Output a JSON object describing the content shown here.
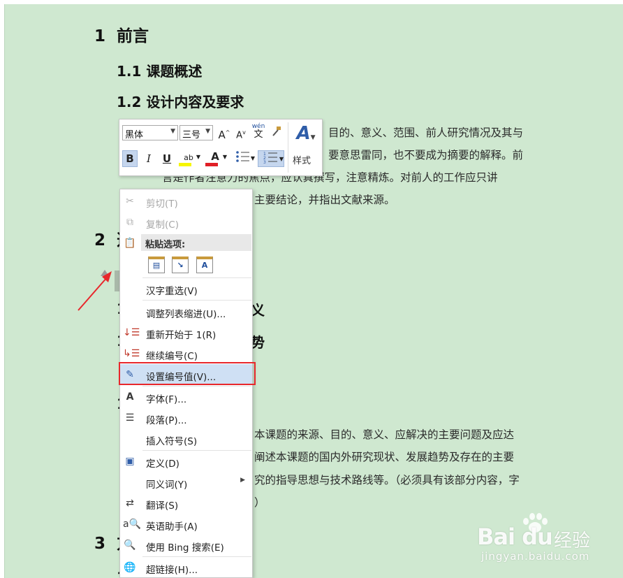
{
  "document": {
    "h1_preface": {
      "num": "1",
      "text": "前言"
    },
    "h2_overview": "1.1 课题概述",
    "h2_design": "1.2 设计内容及要求",
    "para1": [
      "目的、意义、范围、前人研究情况及其与",
      "要意思雷同，也不要成为摘要的解释。前",
      "言是作者注意力的焦点，应认真撰写，注意精炼。对前人的工作应只讲",
      "主要结论，并指出文献来源。"
    ],
    "h1_two": {
      "num": "2",
      "text": "选"
    },
    "partial_headings": [
      "义",
      "势"
    ],
    "row_nums": [
      "1",
      "1",
      "1"
    ],
    "para2": [
      "本课题的来源、目的、意义、应解决的主要问题及应达",
      "阐述本课题的国内外研究现状、发展趋势及存在的主要",
      "究的指导思想与技术路线等。（必须具有该部分内容，字",
      "）"
    ],
    "h1_three": {
      "num": "3",
      "text": "方"
    },
    "last_num": "1"
  },
  "mini_toolbar": {
    "font_name": "黑体",
    "font_size": "三号",
    "grow_font": "A",
    "shrink_font": "A",
    "phonetic": "wén",
    "phonetic_char": "文",
    "bold": "B",
    "italic": "I",
    "underline": "U",
    "highlight_icon": "ab",
    "font_color_icon": "A",
    "styles_icon": "A",
    "styles_label": "样式"
  },
  "context_menu": {
    "cut": "剪切(T)",
    "copy": "复制(C)",
    "paste_options": "粘贴选项:",
    "paste_text_only": "A",
    "reconvert": "汉字重选(V)",
    "adjust_indent": "调整列表缩进(U)...",
    "restart_at": "重新开始于 1(R)",
    "continue_numbering": "继续编号(C)",
    "set_numbering_value": "设置编号值(V)...",
    "font": "字体(F)...",
    "paragraph": "段落(P)...",
    "insert_symbol": "插入符号(S)",
    "define": "定义(D)",
    "synonyms": "同义词(Y)",
    "translate": "翻译(S)",
    "english_assistant": "英语助手(A)",
    "bing_search": "使用 Bing 搜索(E)",
    "hyperlink": "超链接(H)..."
  },
  "watermark": {
    "logo": "Bai du",
    "cn": "经验",
    "url": "jingyan.baidu.com"
  },
  "colors": {
    "page_bg": "#cfe8d0",
    "highlight": "#cfe0f4",
    "red_box": "#e8272c",
    "arrow": "#e8272c"
  }
}
